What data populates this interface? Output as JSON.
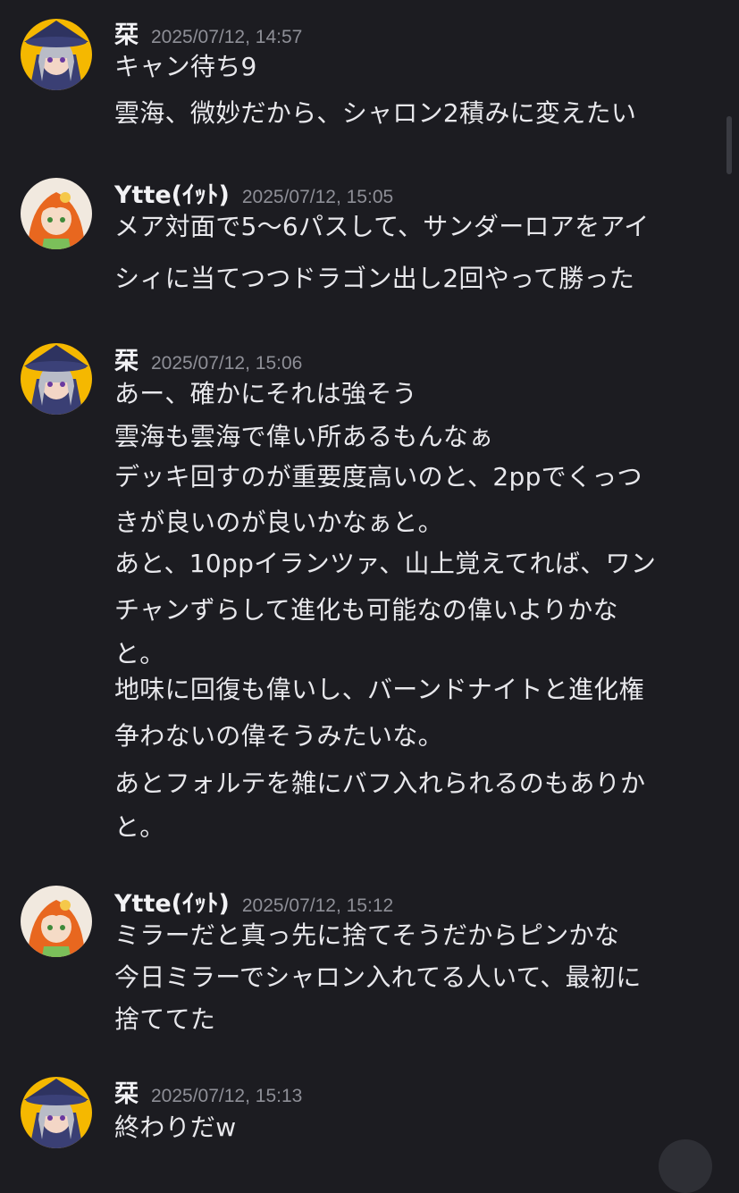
{
  "messages": [
    {
      "author": "栞",
      "timestamp": "2025/07/12, 14:57",
      "avatar": "witch-avatar",
      "lines": [
        "キャン待ち9",
        "雲海、微妙だから、シャロン2積みに変えたい"
      ]
    },
    {
      "author": "Ytte(ｲｯﾄ)",
      "timestamp": "2025/07/12, 15:05",
      "avatar": "orange-hair-avatar",
      "lines": [
        "メア対面で5〜6パスして、サンダーロアをアイ",
        "シィに当てつつドラゴン出し2回やって勝った"
      ]
    },
    {
      "author": "栞",
      "timestamp": "2025/07/12, 15:06",
      "avatar": "witch-avatar",
      "lines": [
        "あー、確かにそれは強そう",
        "雲海も雲海で偉い所あるもんなぁ",
        "デッキ回すのが重要度高いのと、2ppでくっつ",
        "きが良いのが良いかなぁと。",
        "あと、10ppイランツァ、山上覚えてれば、ワン",
        "チャンずらして進化も可能なの偉いよりかな",
        "と。",
        "地味に回復も偉いし、バーンドナイトと進化権",
        "争わないの偉そうみたいな。",
        "あとフォルテを雑にバフ入れられるのもありか",
        "と。"
      ]
    },
    {
      "author": "Ytte(ｲｯﾄ)",
      "timestamp": "2025/07/12, 15:12",
      "avatar": "orange-hair-avatar",
      "lines": [
        "ミラーだと真っ先に捨てそうだからピンかな",
        "今日ミラーでシャロン入れてる人いて、最初に",
        "捨ててた"
      ]
    },
    {
      "author": "栞",
      "timestamp": "2025/07/12, 15:13",
      "avatar": "witch-avatar",
      "lines": [
        "終わりだw"
      ]
    }
  ],
  "colors": {
    "background": "#1c1c21",
    "text": "#e8e8ec",
    "timestamp": "#8e8f97"
  }
}
